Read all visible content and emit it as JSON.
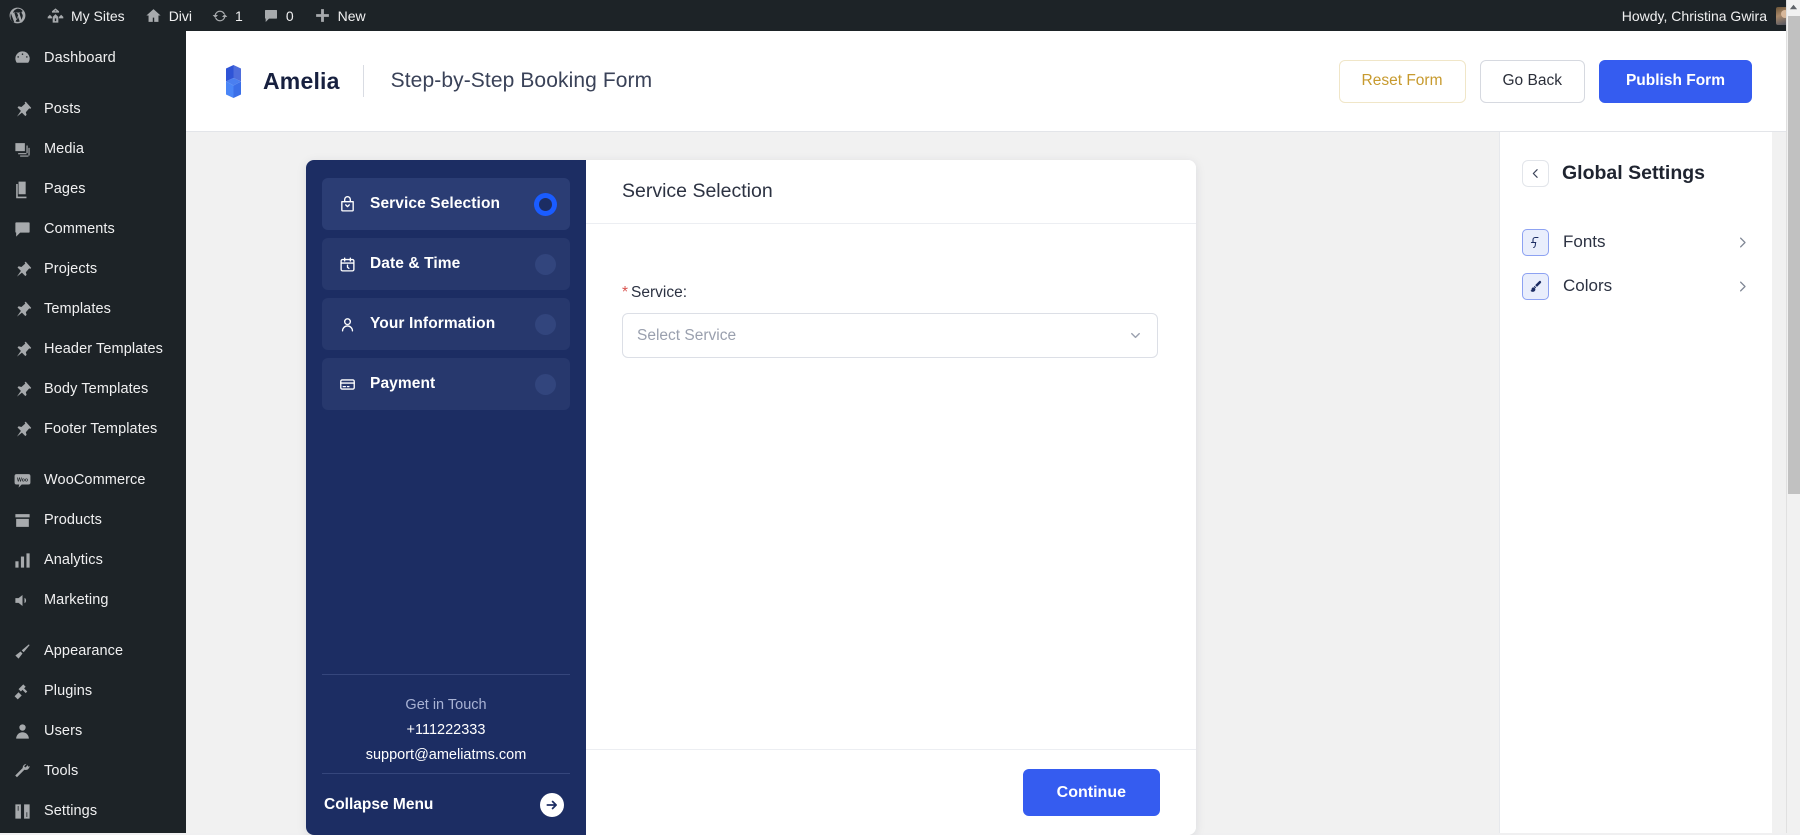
{
  "adminbar": {
    "items": [
      {
        "icon": "wordpress-icon",
        "label": ""
      },
      {
        "icon": "my-sites-icon",
        "label": "My Sites"
      },
      {
        "icon": "home-icon",
        "label": "Divi"
      },
      {
        "icon": "updates-icon",
        "label": "1"
      },
      {
        "icon": "comments-icon",
        "label": "0"
      },
      {
        "icon": "plus-icon",
        "label": "New"
      }
    ],
    "howdy": "Howdy, Christina Gwira"
  },
  "adminmenu": {
    "items": [
      {
        "icon": "dashboard-icon",
        "label": "Dashboard",
        "gap_after": true
      },
      {
        "icon": "pin-icon",
        "label": "Posts"
      },
      {
        "icon": "media-icon",
        "label": "Media"
      },
      {
        "icon": "pages-icon",
        "label": "Pages"
      },
      {
        "icon": "comments-icon",
        "label": "Comments"
      },
      {
        "icon": "pin-icon",
        "label": "Projects"
      },
      {
        "icon": "pin-icon",
        "label": "Templates"
      },
      {
        "icon": "pin-icon",
        "label": "Header Templates"
      },
      {
        "icon": "pin-icon",
        "label": "Body Templates"
      },
      {
        "icon": "pin-icon",
        "label": "Footer Templates",
        "gap_after": true
      },
      {
        "icon": "woocommerce-icon",
        "label": "WooCommerce"
      },
      {
        "icon": "products-icon",
        "label": "Products"
      },
      {
        "icon": "analytics-icon",
        "label": "Analytics"
      },
      {
        "icon": "marketing-icon",
        "label": "Marketing",
        "gap_after": true
      },
      {
        "icon": "appearance-icon",
        "label": "Appearance"
      },
      {
        "icon": "plugins-icon",
        "label": "Plugins"
      },
      {
        "icon": "users-icon",
        "label": "Users"
      },
      {
        "icon": "tools-icon",
        "label": "Tools"
      },
      {
        "icon": "settings-icon",
        "label": "Settings"
      }
    ]
  },
  "header": {
    "brand": "Amelia",
    "form_title": "Step-by-Step Booking Form",
    "reset_label": "Reset Form",
    "goback_label": "Go Back",
    "publish_label": "Publish Form"
  },
  "booking": {
    "steps": [
      {
        "icon": "bag-icon",
        "label": "Service Selection",
        "active": true
      },
      {
        "icon": "calendar-icon",
        "label": "Date & Time",
        "active": false
      },
      {
        "icon": "user-icon",
        "label": "Your Information",
        "active": false
      },
      {
        "icon": "card-icon",
        "label": "Payment",
        "active": false
      }
    ],
    "touch": {
      "title": "Get in Touch",
      "phone": "+111222333",
      "email": "support@ameliatms.com"
    },
    "collapse_label": "Collapse Menu",
    "form": {
      "head_title": "Service Selection",
      "required_mark": "*",
      "service_label": "Service:",
      "service_placeholder": "Select Service",
      "continue_label": "Continue"
    }
  },
  "global_settings": {
    "title": "Global Settings",
    "rows": [
      {
        "icon": "font-icon",
        "label": "Fonts"
      },
      {
        "icon": "brush-icon",
        "label": "Colors"
      }
    ]
  },
  "colors": {
    "accent_blue": "#355cf0",
    "steps_navy": "#1c2d63",
    "reset_gold": "#c79a2e",
    "admin_dark": "#1d2327",
    "required_red": "#d9534f"
  }
}
